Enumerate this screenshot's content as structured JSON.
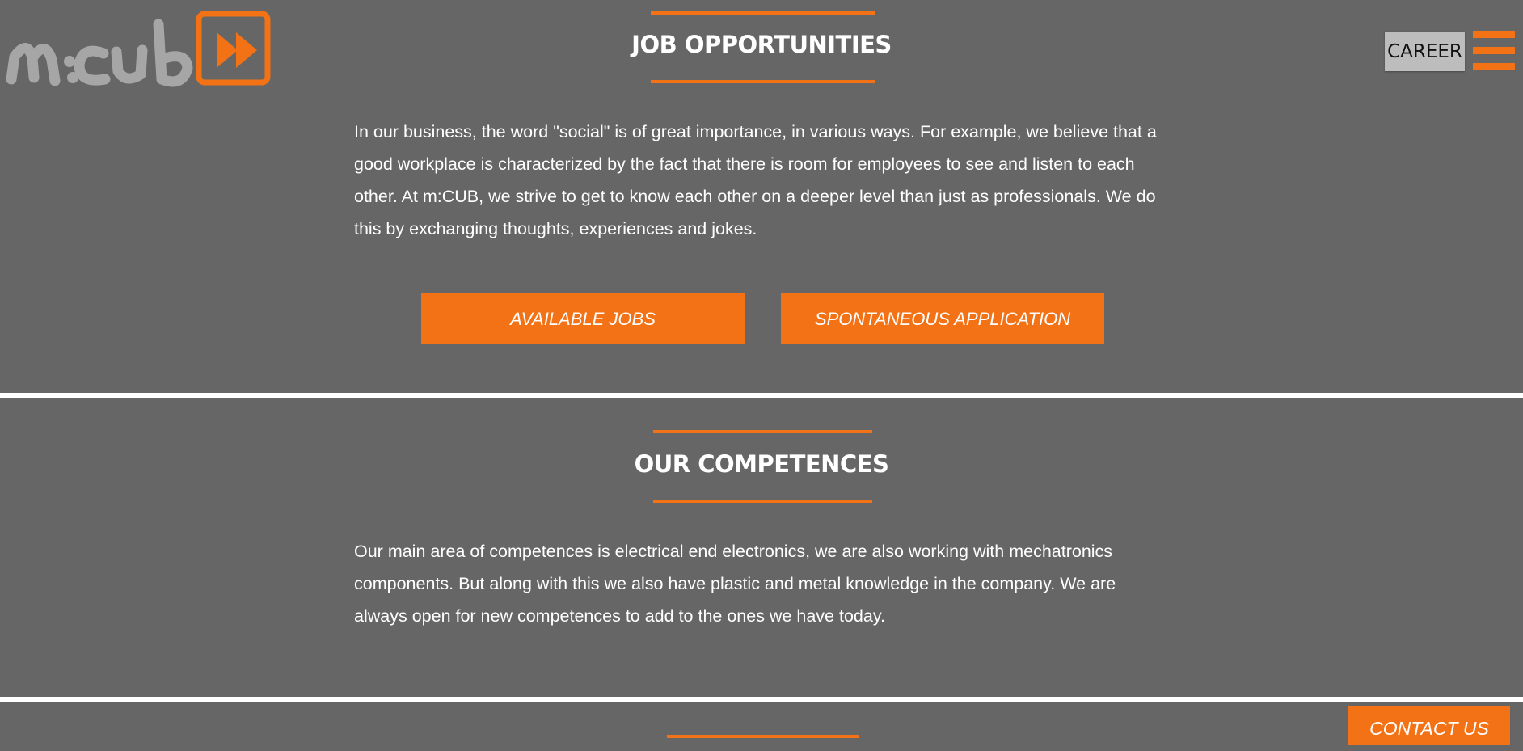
{
  "brand": {
    "logo_icon": "fast-forward-icon",
    "accent_color": "#f37216",
    "logo_gray": "#a6a6a6"
  },
  "header": {
    "career_label": "CAREER",
    "menu_icon": "hamburger-menu-icon"
  },
  "jobs_section": {
    "title": "JOB OPPORTUNITIES",
    "body": "In our business, the word \"social\" is of great importance, in various ways. For example, we believe that a good workplace is characterized by the fact that there is room for employees to see and listen to each other. At m:CUB, we strive to get to know each other on a deeper level than just as professionals. We do this by exchanging thoughts, experiences and jokes.",
    "buttons": {
      "available_jobs": "AVAILABLE JOBS",
      "spontaneous_application": "SPONTANEOUS APPLICATION"
    }
  },
  "competences_section": {
    "title": "OUR COMPETENCES",
    "body": "Our main area of competences is electrical end electronics, we are also working with mechatronics components. But along with this we also have plastic and metal knowledge in the company. We are always open for new competences to add to the ones we have today."
  },
  "contact": {
    "label": "CONTACT US"
  }
}
